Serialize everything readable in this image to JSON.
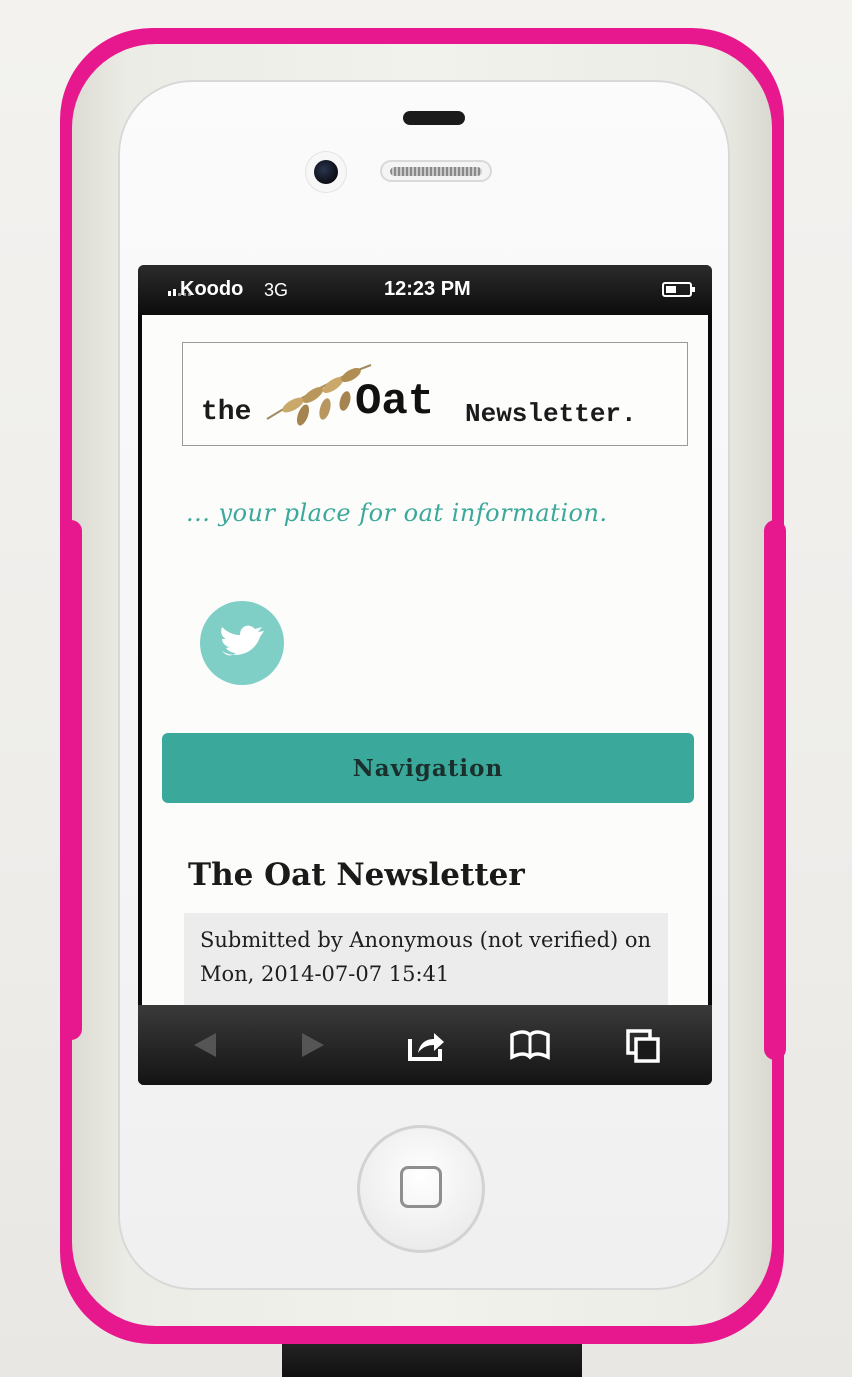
{
  "status_bar": {
    "carrier": "Koodo",
    "network": "3G",
    "time": "12:23 PM",
    "signal_icon": "signal-bars-icon",
    "battery_icon": "battery-icon"
  },
  "website": {
    "logo": {
      "word1": "the",
      "word2": "Oat",
      "word3": "Newsletter."
    },
    "tagline": "... your place for oat information.",
    "social_icon": "twitter-bird-icon",
    "navigation_label": "Navigation",
    "article": {
      "title": "The Oat Newsletter",
      "submitted": "Submitted by Anonymous (not verified) on Mon, 2014-07-07 15:41"
    }
  },
  "safari_toolbar": {
    "icons": [
      "back-arrow-icon",
      "forward-arrow-icon",
      "share-icon",
      "bookmarks-icon",
      "tabs-icon"
    ]
  },
  "colors": {
    "case_pink": "#e7178d",
    "accent_teal": "#3aa89a",
    "twitter_teal": "#7fcfc6"
  }
}
